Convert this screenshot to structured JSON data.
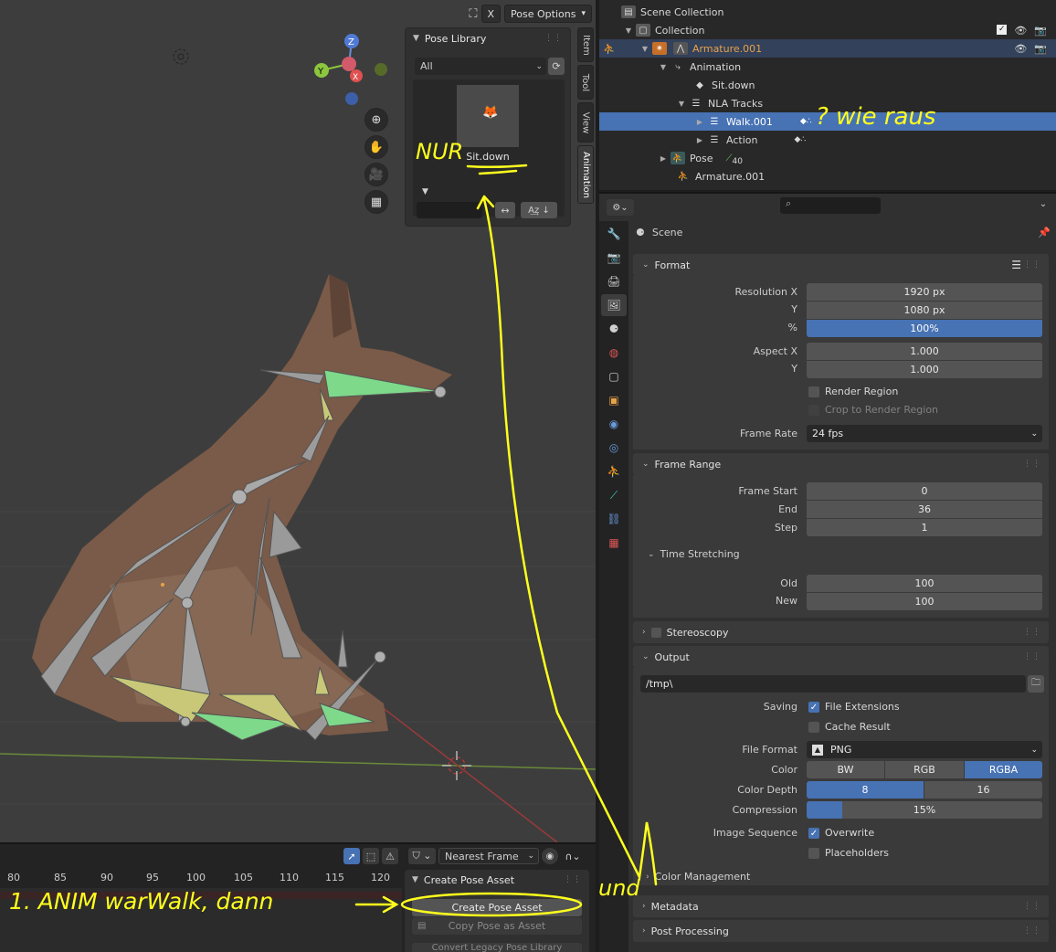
{
  "viewport": {
    "pose_options_label": "Pose Options",
    "x_label": "X"
  },
  "pose_library": {
    "title": "Pose Library",
    "filter_value": "All",
    "asset_name": "Sit.down"
  },
  "side_tabs": [
    "Item",
    "Tool",
    "View",
    "Animation"
  ],
  "timeline": {
    "ticks": [
      "80",
      "85",
      "90",
      "95",
      "100",
      "105",
      "110",
      "115",
      "120"
    ],
    "snap_mode": "Nearest Frame",
    "create_panel_title": "Create Pose Asset",
    "create_button": "Create Pose Asset",
    "copy_button": "Copy Pose as Asset",
    "convert_button": "Convert Legacy Pose Library"
  },
  "outliner": {
    "rows": [
      {
        "label": "Scene Collection"
      },
      {
        "label": "Collection"
      },
      {
        "label": "Armature.001"
      },
      {
        "label": "Animation"
      },
      {
        "label": "Sit.down"
      },
      {
        "label": "NLA Tracks"
      },
      {
        "label": "Walk.001"
      },
      {
        "label": "Action"
      },
      {
        "label": "Pose",
        "badge": "40"
      },
      {
        "label": "Armature.001"
      }
    ]
  },
  "properties": {
    "context": "Scene",
    "format": {
      "title": "Format",
      "res_x_label": "Resolution X",
      "res_x": "1920 px",
      "res_y_label": "Y",
      "res_y": "1080 px",
      "pct_label": "%",
      "pct": "100%",
      "aspect_x_label": "Aspect X",
      "aspect_x": "1.000",
      "aspect_y_label": "Y",
      "aspect_y": "1.000",
      "render_region": "Render Region",
      "crop_region": "Crop to Render Region",
      "frame_rate_label": "Frame Rate",
      "frame_rate": "24 fps"
    },
    "frame_range": {
      "title": "Frame Range",
      "start_label": "Frame Start",
      "start": "0",
      "end_label": "End",
      "end": "36",
      "step_label": "Step",
      "step": "1",
      "time_stretching": "Time Stretching",
      "old_label": "Old",
      "old": "100",
      "new_label": "New",
      "new": "100"
    },
    "stereoscopy": "Stereoscopy",
    "output": {
      "title": "Output",
      "path": "/tmp\\",
      "saving_label": "Saving",
      "file_extensions": "File Extensions",
      "cache_result": "Cache Result",
      "file_format_label": "File Format",
      "file_format": "PNG",
      "color_label": "Color",
      "color_options": [
        "BW",
        "RGB",
        "RGBA"
      ],
      "color_depth_label": "Color Depth",
      "depth_options": [
        "8",
        "16"
      ],
      "compression_label": "Compression",
      "compression": "15%",
      "compression_value": 0.15,
      "image_sequence_label": "Image Sequence",
      "overwrite": "Overwrite",
      "placeholders": "Placeholders"
    },
    "color_management": "Color Management",
    "metadata": "Metadata",
    "post_processing": "Post Processing"
  },
  "annotations": {
    "nur": "NUR",
    "wie_raus": "? wie raus",
    "anim": "1. ANIM warWalk, dann",
    "und": "und"
  },
  "colors": {
    "selection": "#4772b3",
    "annotation": "#ffff1e",
    "armature_orange": "#e8a24a"
  }
}
